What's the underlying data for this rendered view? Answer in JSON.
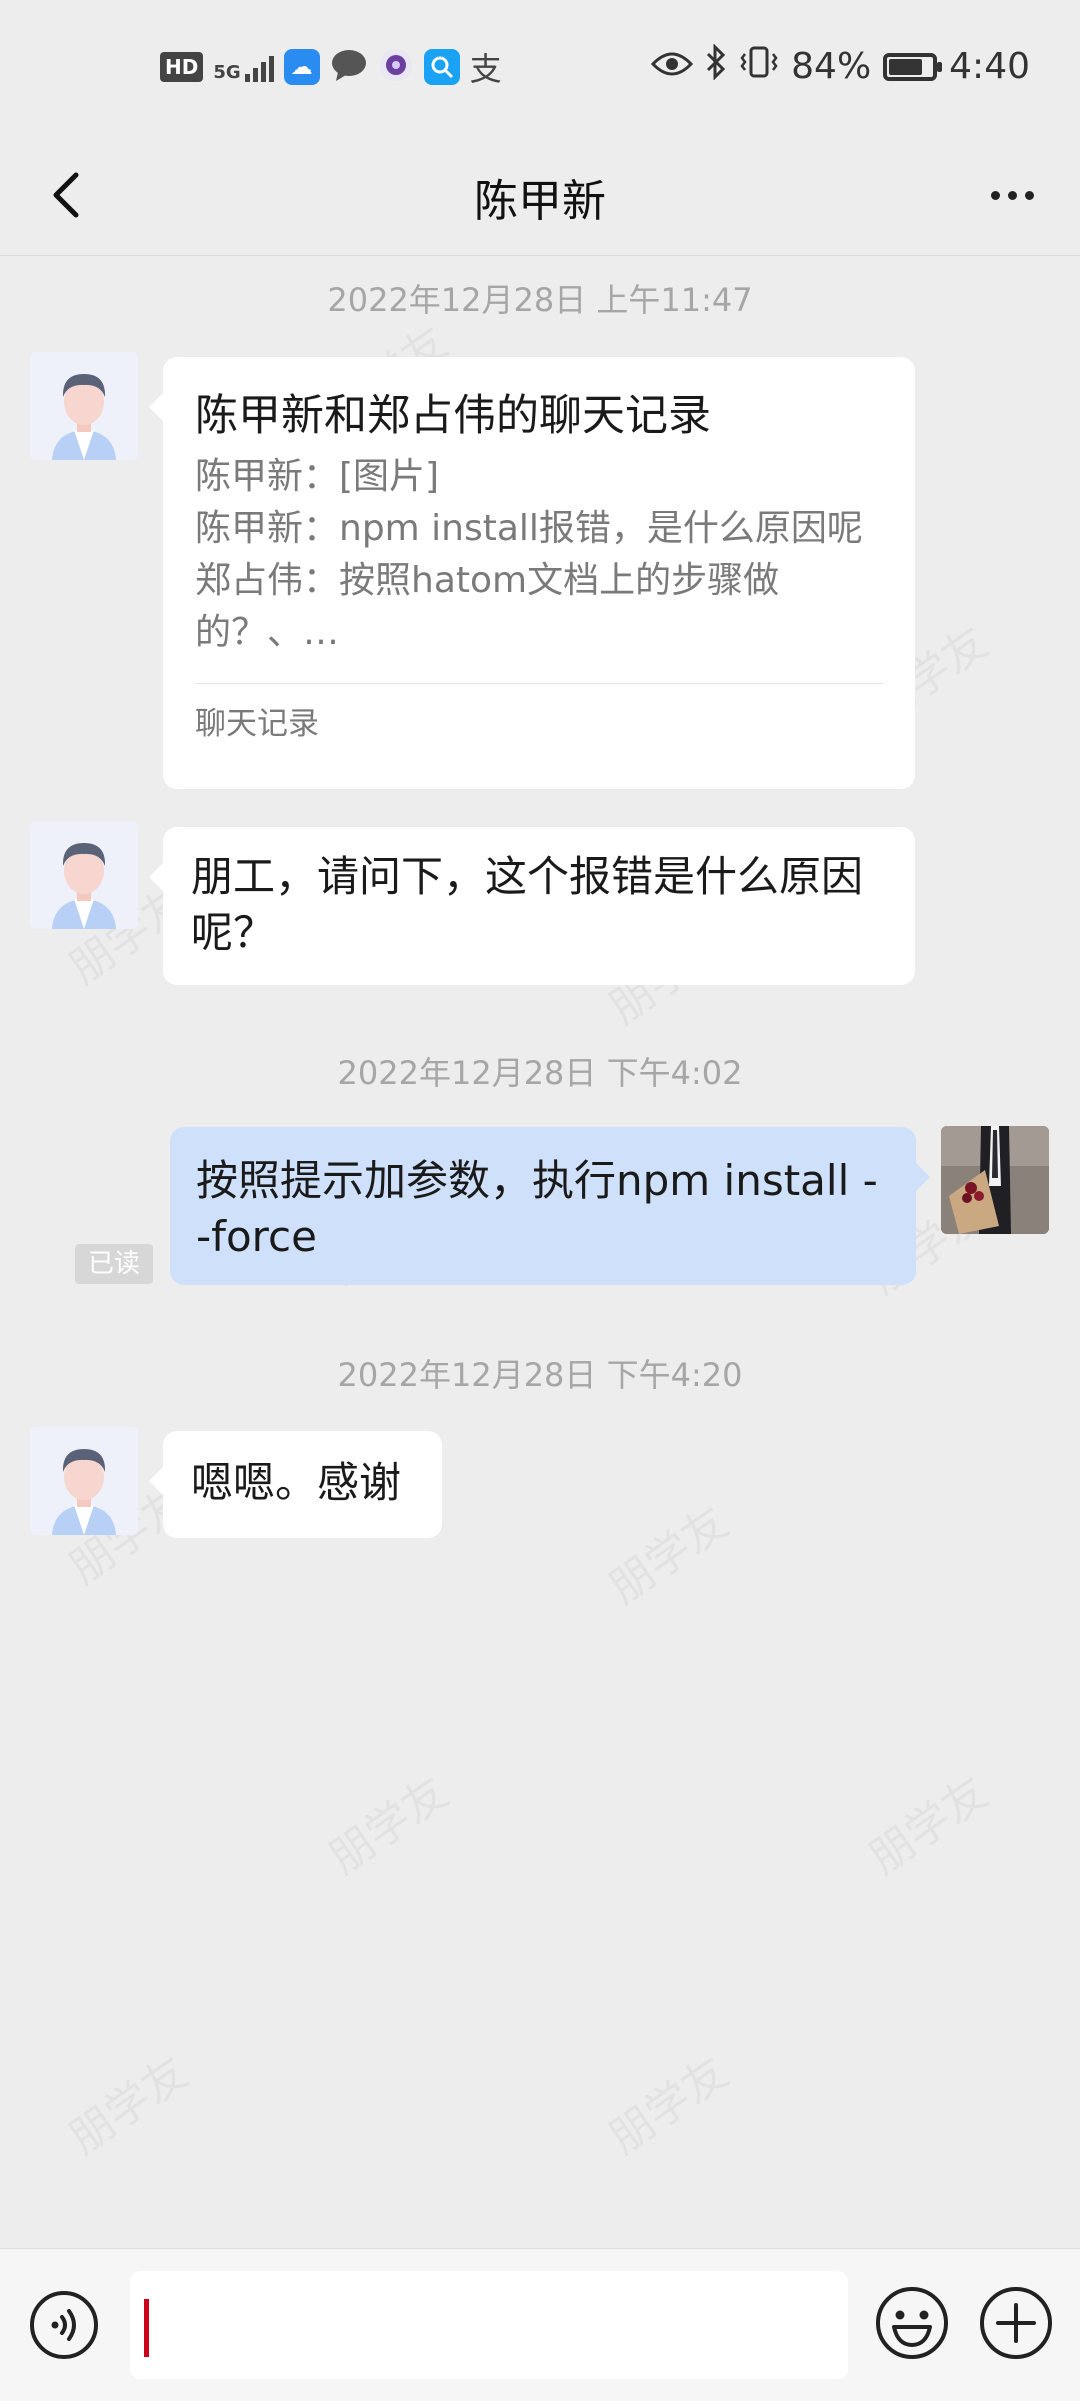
{
  "status_bar": {
    "hd": "HD",
    "network": "5G",
    "battery_percent": "84%",
    "battery_level": 0.84,
    "time": "4:40",
    "icons": [
      "hd-icon",
      "signal-icon",
      "weather-app-icon",
      "message-app-icon",
      "camera-app-icon",
      "search-app-icon",
      "alipay-icon",
      "eye-comfort-icon",
      "bluetooth-icon",
      "vibrate-icon",
      "battery-icon"
    ]
  },
  "header": {
    "title": "陈甲新"
  },
  "messages": [
    {
      "timestamp": "2022年12月28日 上午11:47",
      "type": "chat-record-card",
      "card": {
        "title": "陈甲新和郑占伟的聊天记录",
        "lines": [
          "陈甲新：[图片]",
          "陈甲新：npm install报错，是什么原因呢",
          "郑占伟：按照hatom文档上的步骤做",
          "的？、…"
        ],
        "footer": "聊天记录"
      }
    },
    {
      "type": "text-in",
      "text": "朋工，请问下，这个报错是什么原因呢？"
    },
    {
      "timestamp": "2022年12月28日 下午4:02",
      "type": "text-out",
      "text": "按照提示加参数，执行npm install --force",
      "read_label": "已读"
    },
    {
      "timestamp": "2022年12月28日 下午4:20",
      "type": "text-in",
      "text": "嗯嗯。感谢"
    }
  ],
  "watermark": "朋学友",
  "colors": {
    "background": "#ededed",
    "outgoing_bubble": "#cfe0fb",
    "incoming_bubble": "#ffffff",
    "cursor": "#d0021b"
  }
}
